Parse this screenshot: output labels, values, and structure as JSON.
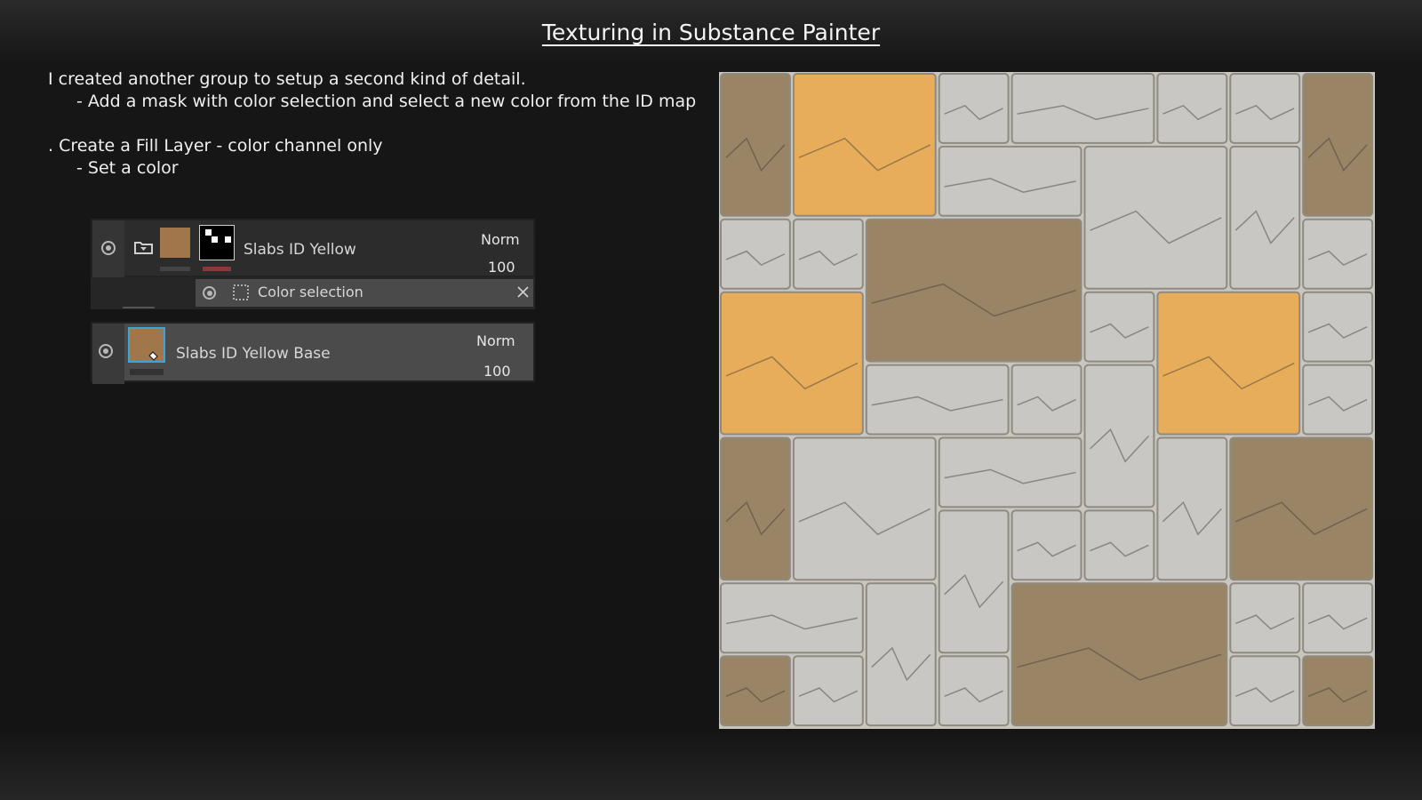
{
  "slide": {
    "title": "Texturing in Substance Painter"
  },
  "instructions": {
    "line1": "I created another group to setup a second kind of detail.",
    "line2": "- Add a mask with color selection and select a new color from the ID map",
    "line3": ". Create a Fill Layer - color channel only",
    "line4": "- Set a color"
  },
  "layers": {
    "group": {
      "name": "Slabs ID Yellow",
      "blend_mode": "Norm",
      "opacity": "100"
    },
    "mask_effect": {
      "name": "Color selection"
    },
    "fill": {
      "name": "Slabs ID Yellow Base",
      "blend_mode": "Norm",
      "opacity": "100"
    }
  },
  "colors": {
    "fill_swatch": "#a0764a",
    "selected_outline": "#3aa6d8",
    "yellow_slab": "#e8ad5a",
    "grey_slab": "#c8c7c4",
    "brown_slab": "#9a8466"
  }
}
